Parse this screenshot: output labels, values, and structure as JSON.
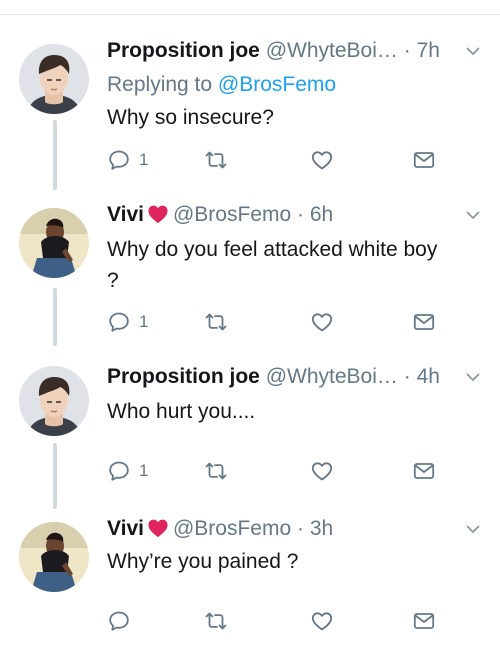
{
  "tweets": [
    {
      "name": "Proposition joe",
      "handle": "@WhyteBoi…",
      "time": "7h",
      "replying_label": "Replying to",
      "replying_mention": "@BrosFemo",
      "text": "Why so insecure?",
      "reply_count": "1",
      "heart_badge": false
    },
    {
      "name": "Vivi",
      "handle": "@BrosFemo",
      "time": "6h",
      "text": "Why do you feel attacked white boy ?",
      "reply_count": "1",
      "heart_badge": true
    },
    {
      "name": "Proposition joe",
      "handle": "@WhyteBoi…",
      "time": "4h",
      "text": "Who hurt you....",
      "reply_count": "1",
      "heart_badge": false
    },
    {
      "name": "Vivi",
      "handle": "@BrosFemo",
      "time": "3h",
      "text": "Why’re you pained ?",
      "reply_count": "",
      "heart_badge": true
    }
  ],
  "separator": "·",
  "colors": {
    "text": "#14171a",
    "secondary": "#657786",
    "link": "#1da1f2",
    "heart_badge": "#e0245e",
    "thread_line": "#cfd9de"
  },
  "icons": [
    "reply-icon",
    "retweet-icon",
    "like-icon",
    "share-mail-icon",
    "caret-down-icon",
    "heart-emoji-icon"
  ]
}
